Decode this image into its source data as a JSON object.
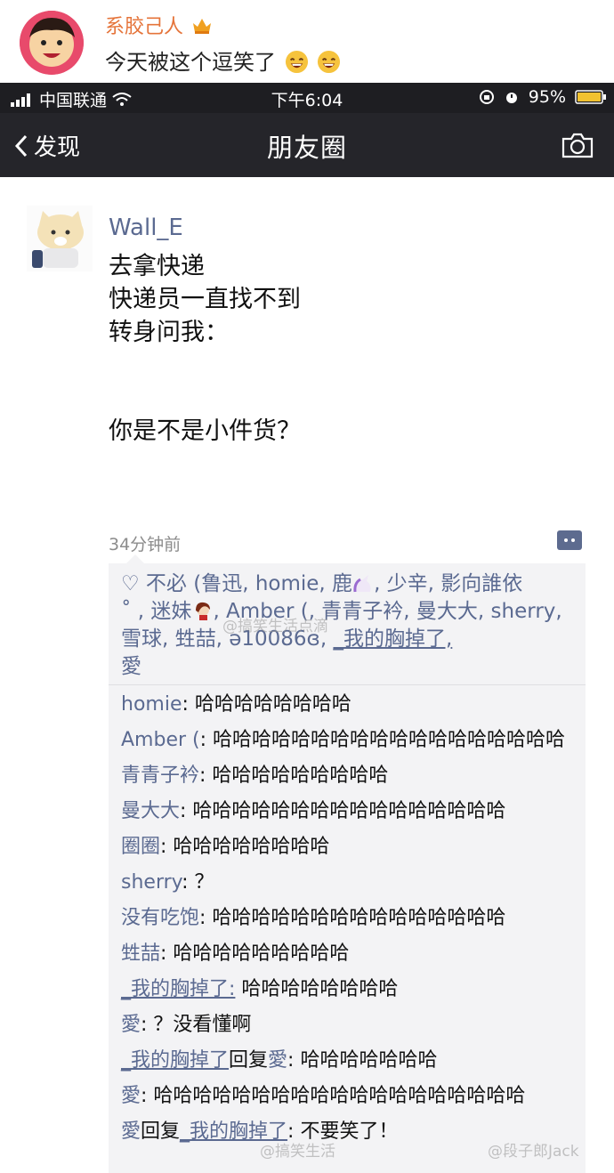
{
  "weibo": {
    "username": "系胶己人",
    "post_text": "今天被这个逗笑了"
  },
  "statusbar": {
    "carrier": "中国联通",
    "time": "下午6:04",
    "battery": "95%"
  },
  "navbar": {
    "back_label": "发现",
    "title": "朋友圈"
  },
  "post": {
    "author": "Wall_E",
    "body": "去拿快递\n快递员一直找不到\n转身问我：\n\n\n你是不是小件货？",
    "time": "34分钟前"
  },
  "likes": {
    "prefix": " 不必 (鲁迅, homie, 鹿",
    "mid1": ", 少辛, 影向誰依",
    "mid2": "˚ , 迷妹",
    "mid3": ", Amber (, 青青子衿, 曼大大, sherry, 雪球, 甡喆, ə10086ɞ, ",
    "link": "_我的胸掉了,",
    "suffix": " 愛"
  },
  "comments": [
    {
      "user": "homie",
      "sep": ": ",
      "text": "哈哈哈哈哈哈哈哈"
    },
    {
      "user": "Amber (",
      "sep": ": ",
      "text": "哈哈哈哈哈哈哈哈哈哈哈哈哈哈哈哈哈哈"
    },
    {
      "user": "青青子衿",
      "sep": ": ",
      "text": "哈哈哈哈哈哈哈哈哈"
    },
    {
      "user": "曼大大",
      "sep": ": ",
      "text": "哈哈哈哈哈哈哈哈哈哈哈哈哈哈哈哈"
    },
    {
      "user": "圈圈",
      "sep": ": ",
      "text": "哈哈哈哈哈哈哈哈"
    },
    {
      "user": "sherry",
      "sep": ": ",
      "text": "？"
    },
    {
      "user": "没有吃饱",
      "sep": ": ",
      "text": "哈哈哈哈哈哈哈哈哈哈哈哈哈哈哈"
    },
    {
      "user": "甡喆",
      "sep": ": ",
      "text": "哈哈哈哈哈哈哈哈哈"
    },
    {
      "user": "_我的胸掉了:",
      "sep": " ",
      "text": "哈哈哈哈哈哈哈哈"
    },
    {
      "user": "愛",
      "sep": ": ",
      "text": "？没看懂啊"
    },
    {
      "user": "_我的胸掉了",
      "reply_word": "回复",
      "reply_to": "愛",
      "sep": ": ",
      "text": "哈哈哈哈哈哈哈"
    },
    {
      "user": "愛",
      "sep": ": ",
      "text": "哈哈哈哈哈哈哈哈哈哈哈哈哈哈哈哈哈哈哈"
    },
    {
      "user": "愛",
      "reply_word": "回复",
      "reply_to": "_我的胸掉了",
      "sep": ": ",
      "text": "不要笑了！"
    }
  ],
  "watermarks": {
    "wm1": "@搞笑生活点滴",
    "wm2": "@搞笑生活",
    "wm3": "@段子郎Jack"
  },
  "colors": {
    "weibo_name": "#e5743a",
    "wechat_link": "#5b6a91",
    "navbar": "#25252a",
    "comment_bg": "#f3f3f5"
  }
}
